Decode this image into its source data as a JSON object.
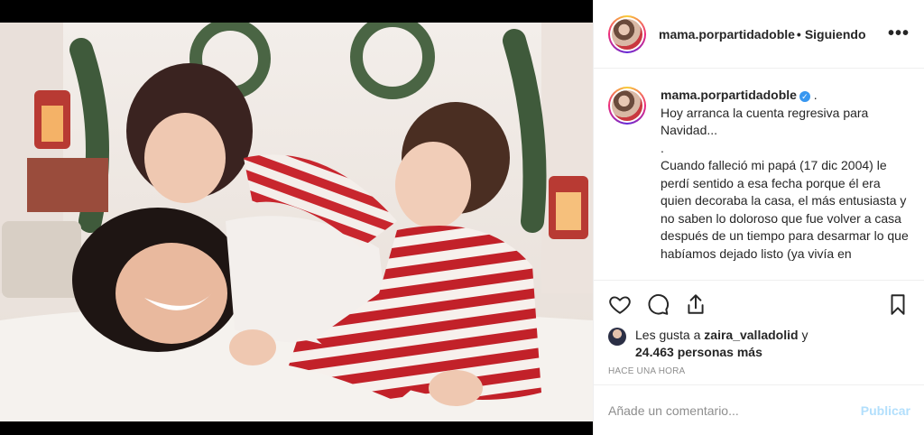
{
  "post": {
    "username": "mama.porpartidadoble",
    "separator": "•",
    "follow_status": "Siguiendo",
    "more_icon": "more-options-icon"
  },
  "caption": {
    "username": "mama.porpartidadoble",
    "verified_icon": "verified-badge-icon",
    "text": " .\nHoy arranca la cuenta regresiva para Navidad...\n.\nCuando falleció mi papá (17 dic 2004) le perdí sentido a esa fecha porque él era quien decoraba la casa, el más entusiasta y no saben lo doloroso que fue volver a casa después de un tiempo para desarmar lo que habíamos dejado listo (ya vivía en"
  },
  "actions": {
    "like_icon": "heart-icon",
    "comment_icon": "comment-bubble-icon",
    "share_icon": "share-icon",
    "save_icon": "bookmark-icon"
  },
  "likes": {
    "prefix": "Les gusta a ",
    "user": "zaira_valladolid",
    "connector": " y",
    "others": "24.463 personas más"
  },
  "timestamp": "HACE UNA HORA",
  "comment_box": {
    "placeholder": "Añade un comentario...",
    "publish_label": "Publicar"
  },
  "colors": {
    "accent_blue": "#3897f0",
    "publish_disabled": "#b2dffc",
    "muted": "#8e8e8e",
    "text": "#262626"
  }
}
